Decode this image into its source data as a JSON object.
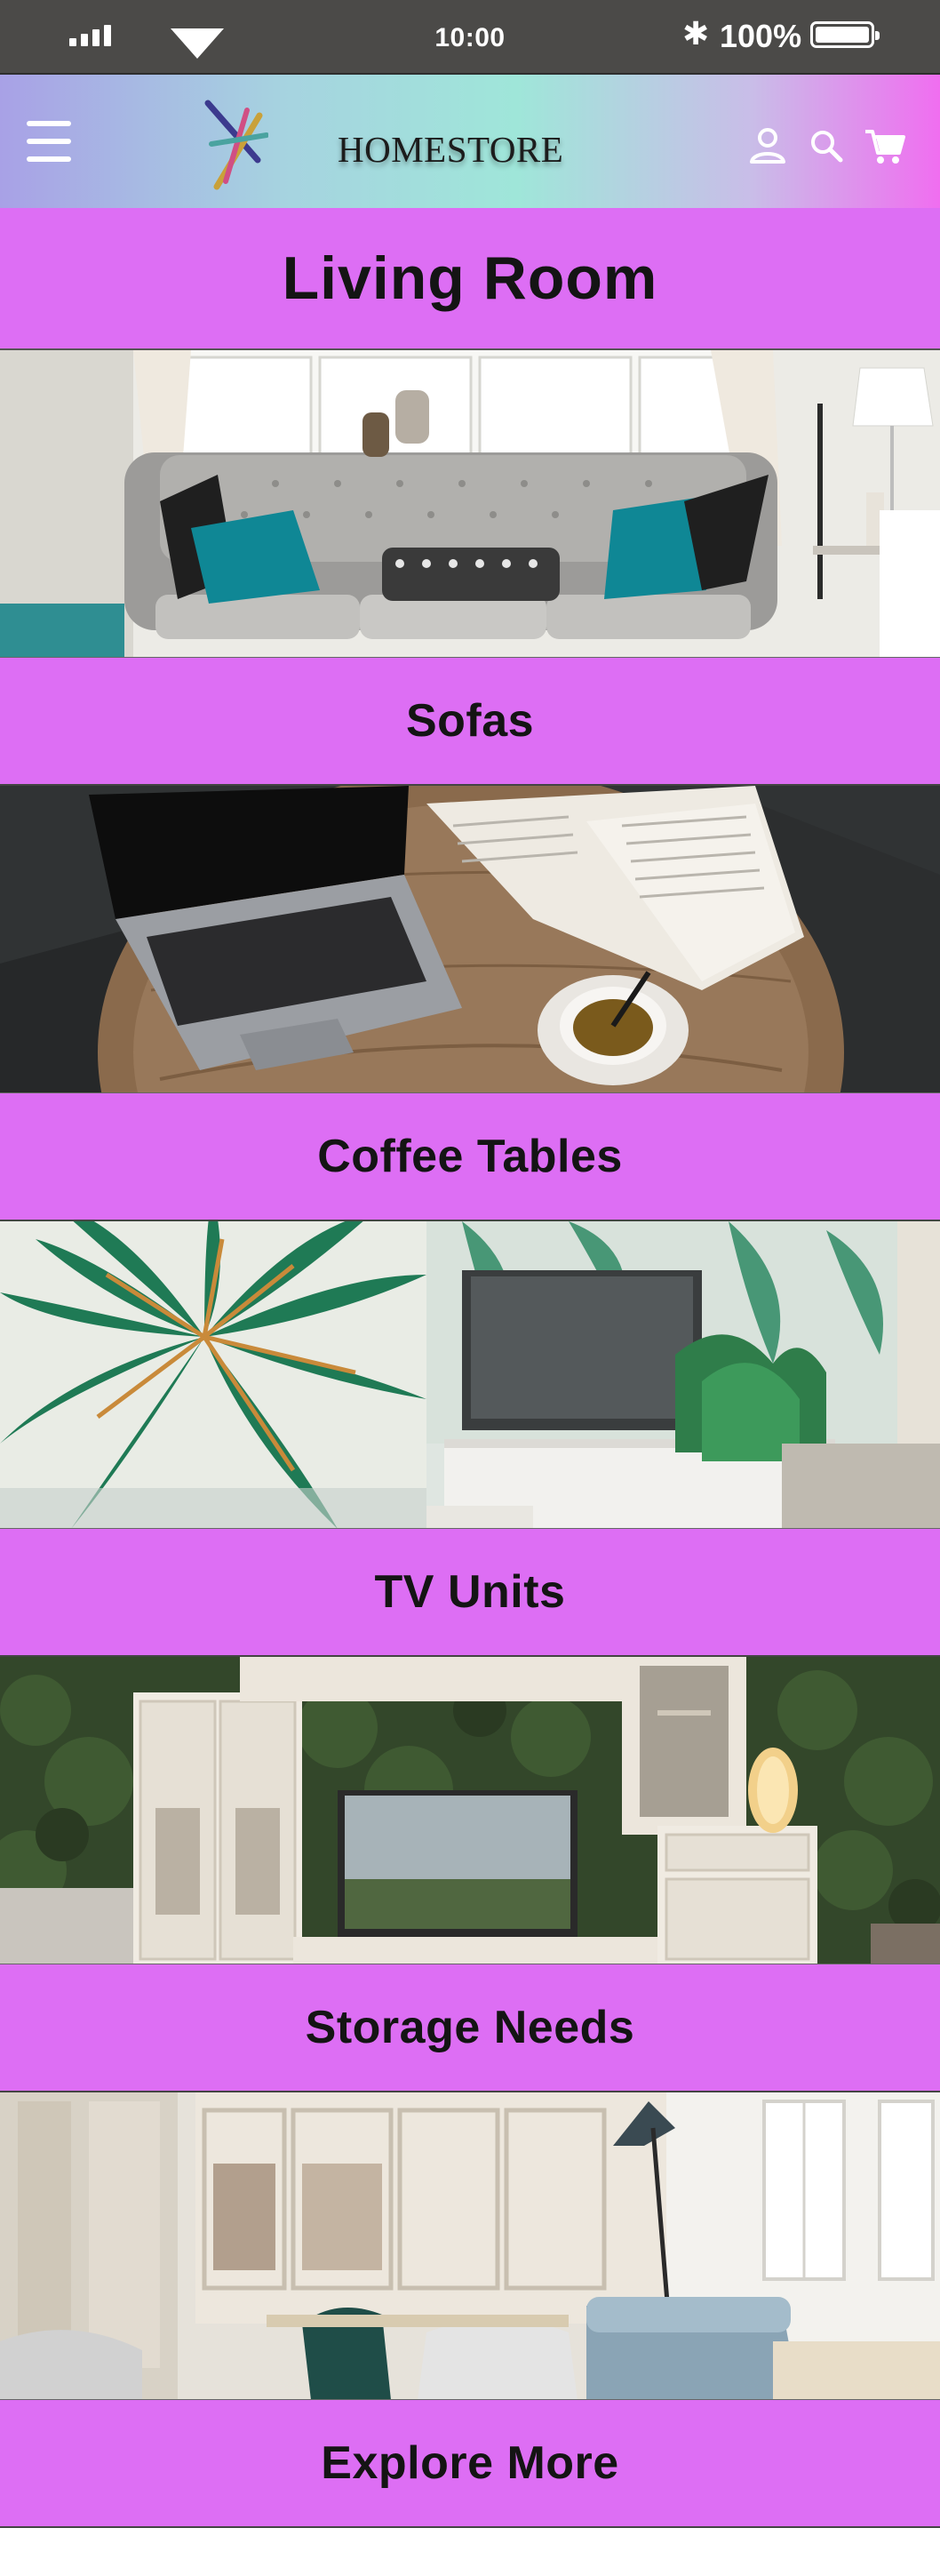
{
  "status_bar": {
    "time": "10:00",
    "battery_text": "100%",
    "icons": [
      "signal-icon",
      "wifi-icon",
      "bluetooth-icon",
      "battery-icon"
    ]
  },
  "header": {
    "brand": "HOMESTORE",
    "icons": [
      "menu-icon",
      "logo-icon",
      "account-icon",
      "search-icon",
      "cart-icon"
    ],
    "gradient_colors": [
      "#a8a1e6",
      "#9fe6d9",
      "#f06ef0"
    ]
  },
  "page": {
    "title": "Living Room"
  },
  "categories": [
    {
      "label": "Sofas",
      "image": "sofa-photo"
    },
    {
      "label": "Coffee Tables",
      "image": "coffee-table-photo"
    },
    {
      "label": "TV Units",
      "image": "tv-unit-photo"
    },
    {
      "label": "Storage Needs",
      "image": "storage-photo"
    },
    {
      "label": "Explore More",
      "image": "explore-photo"
    }
  ],
  "colors": {
    "band": "#dd6ef4",
    "status_bar": "#4b4a48"
  }
}
